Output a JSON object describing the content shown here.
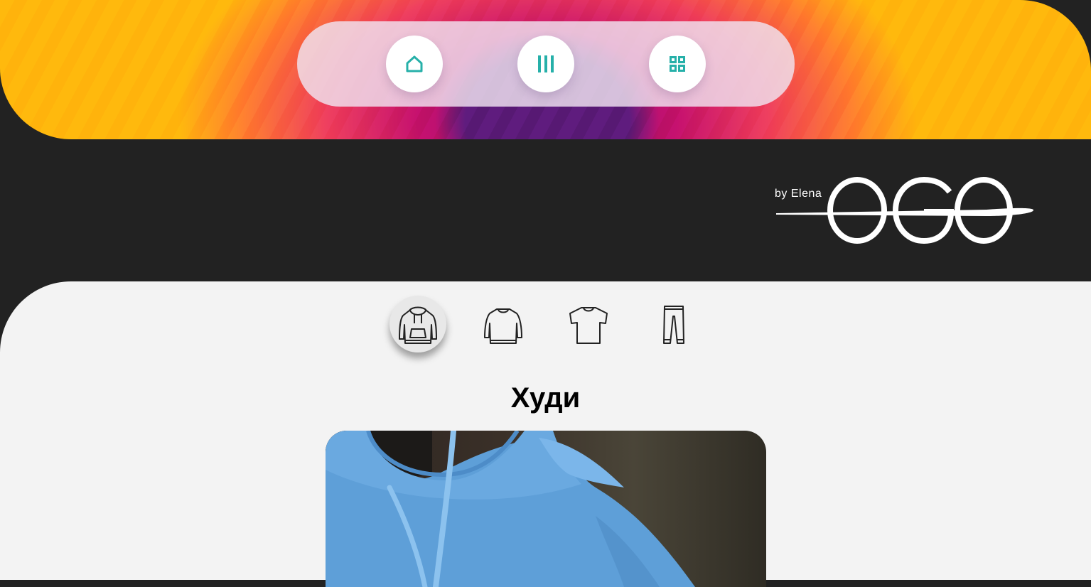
{
  "header": {
    "nav_buttons": [
      {
        "icon": "home-icon",
        "color": "#26b0a9"
      },
      {
        "icon": "menu-columns-icon",
        "color": "#26b0a9"
      },
      {
        "icon": "grid-icon",
        "color": "#26b0a9"
      }
    ],
    "accent_color": "#26b0a9"
  },
  "brand": {
    "byline": "by Elena",
    "logo_text": "EGO"
  },
  "categories": [
    {
      "icon": "hoodie-icon",
      "active": true
    },
    {
      "icon": "sweatshirt-icon",
      "active": false
    },
    {
      "icon": "tshirt-icon",
      "active": false
    },
    {
      "icon": "pants-icon",
      "active": false
    }
  ],
  "section": {
    "title": "Худи"
  }
}
